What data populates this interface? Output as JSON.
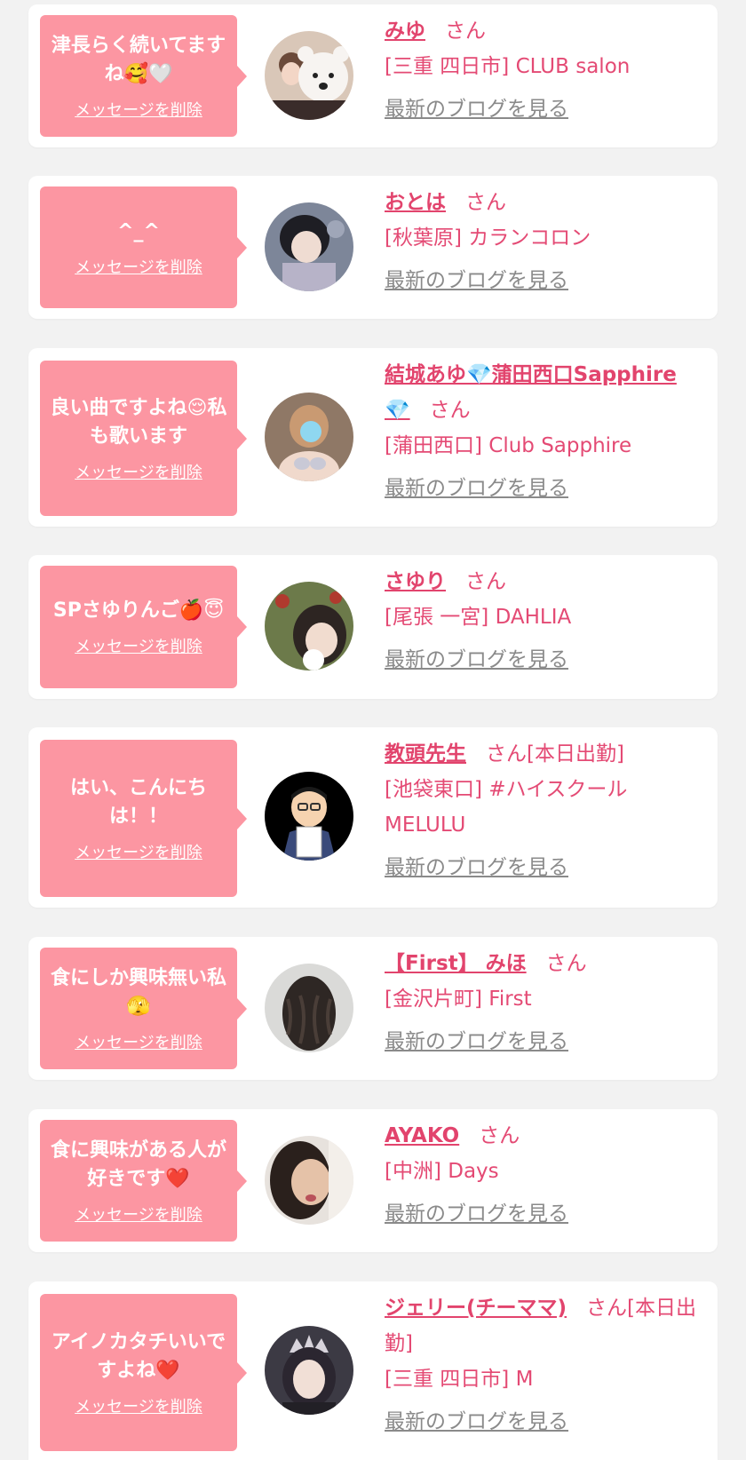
{
  "delete_label": "メッセージを削除",
  "blog_label": "最新のブログを見る",
  "san_label": "さん",
  "colors": {
    "bubble": "#fc96a2",
    "name": "#e2446d",
    "text": "#e44a74",
    "blog": "#8a8a8a",
    "background": "#f2f2f2"
  },
  "messages": [
    {
      "message": "津長らく続いてますね🥰🤍",
      "name": "みゆ",
      "suffix": "",
      "shop": "[三重 四日市] CLUB salon"
    },
    {
      "message": "^_^",
      "name": "おとは",
      "suffix": "",
      "shop": "[秋葉原] カランコロン"
    },
    {
      "message": "良い曲ですよね😌私も歌います",
      "name": "結城あゆ💎蒲田西口Sapphire💎",
      "suffix": "",
      "shop": "[蒲田西口] Club Sapphire"
    },
    {
      "message": "SPさゆりんご🍎😇",
      "name": "さゆり",
      "suffix": "",
      "shop": "[尾張 一宮] DAHLIA"
    },
    {
      "message": "はい、こんにちは！！",
      "name": "教頭先生",
      "suffix": "[本日出勤]",
      "shop": "[池袋東口] #ハイスクールMELULU"
    },
    {
      "message": "食にしか興味無い私🫣",
      "name": "【First】 みほ",
      "suffix": "",
      "shop": "[金沢片町] First"
    },
    {
      "message": "食に興味がある人が好きです❤️",
      "name": "AYAKO",
      "suffix": "",
      "shop": "[中洲] Days"
    },
    {
      "message": "アイノカタチいいですよね❤️",
      "name": "ジェリー(チーママ)",
      "suffix": "[本日出勤]",
      "shop": "[三重 四日市] M"
    }
  ]
}
